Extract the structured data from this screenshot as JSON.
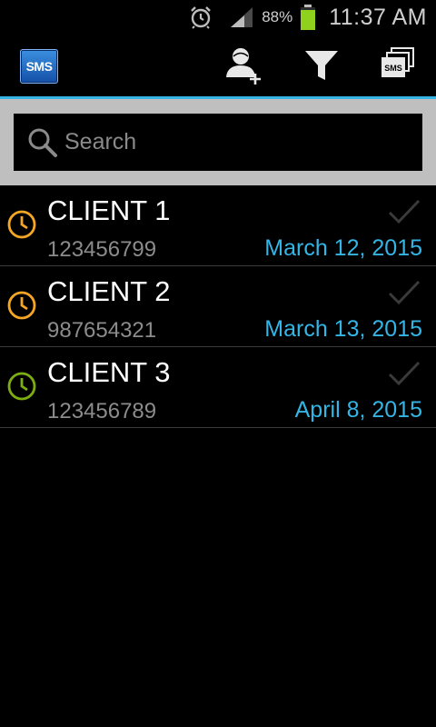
{
  "status_bar": {
    "battery_percent": "88%",
    "battery_level": 0.88,
    "time": "11:37 AM"
  },
  "action_bar": {
    "logo_text": "SMS",
    "icons": [
      "add-contact-icon",
      "filter-icon",
      "sms-messages-icon"
    ]
  },
  "search": {
    "placeholder": "Search",
    "value": ""
  },
  "clients": [
    {
      "name": "CLIENT 1",
      "phone": "123456799",
      "date": "March 12, 2015",
      "clock_color": "#f5a623"
    },
    {
      "name": "CLIENT 2",
      "phone": "987654321",
      "date": "March 13, 2015",
      "clock_color": "#f5a623"
    },
    {
      "name": "CLIENT 3",
      "phone": "123456789",
      "date": "April 8, 2015",
      "clock_color": "#7cae12"
    }
  ],
  "colors": {
    "accent": "#33b5e5",
    "secondary_text": "#8c8c8c",
    "search_frame": "#bfbfbf",
    "battery": "#8fd11c"
  }
}
